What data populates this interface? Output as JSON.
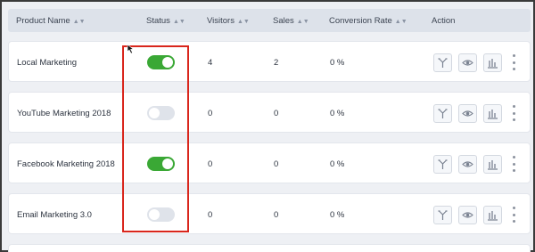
{
  "table": {
    "columns": {
      "product_name": "Product Name",
      "status": "Status",
      "visitors": "Visitors",
      "sales": "Sales",
      "conversion_rate": "Conversion Rate",
      "action": "Action"
    },
    "rows": [
      {
        "name": "Local Marketing",
        "status_on": true,
        "visitors": "4",
        "sales": "2",
        "conversion": "0 %"
      },
      {
        "name": "YouTube Marketing 2018",
        "status_on": false,
        "visitors": "0",
        "sales": "0",
        "conversion": "0 %"
      },
      {
        "name": "Facebook Marketing 2018",
        "status_on": true,
        "visitors": "0",
        "sales": "0",
        "conversion": "0 %"
      },
      {
        "name": "Email Marketing 3.0",
        "status_on": false,
        "visitors": "0",
        "sales": "0",
        "conversion": "0 %"
      }
    ]
  },
  "colors": {
    "toggle_on": "#3aa835",
    "toggle_off": "#dfe3ea",
    "highlight_border": "#d9261c",
    "header_bg": "#dde2ea"
  },
  "icons": {
    "sort": "sort-icon",
    "action_1": "split-icon",
    "action_2": "eye-icon",
    "action_3": "bar-chart-icon",
    "more": "kebab-menu-icon"
  }
}
